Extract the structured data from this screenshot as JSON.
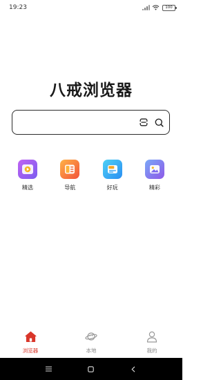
{
  "status": {
    "time": "19:23",
    "battery": "100"
  },
  "app": {
    "title": "八戒浏览器"
  },
  "search": {
    "value": "",
    "placeholder": ""
  },
  "quick_links": [
    {
      "label": "精选",
      "icon": "play-video-icon",
      "color": "#9b5ff2"
    },
    {
      "label": "导航",
      "icon": "navigation-icon",
      "color": "#f57a3b"
    },
    {
      "label": "好玩",
      "icon": "new-game-icon",
      "color": "#34a6f3"
    },
    {
      "label": "精彩",
      "icon": "picture-gallery-icon",
      "color": "#8272ec"
    }
  ],
  "tabs": [
    {
      "label": "浏览器",
      "icon": "home-icon",
      "active": true
    },
    {
      "label": "本地",
      "icon": "planet-icon",
      "active": false
    },
    {
      "label": "我的",
      "icon": "user-icon",
      "active": false
    }
  ],
  "colors": {
    "accent": "#d9362a",
    "text": "#1a1a1a",
    "inactive": "#888888"
  }
}
